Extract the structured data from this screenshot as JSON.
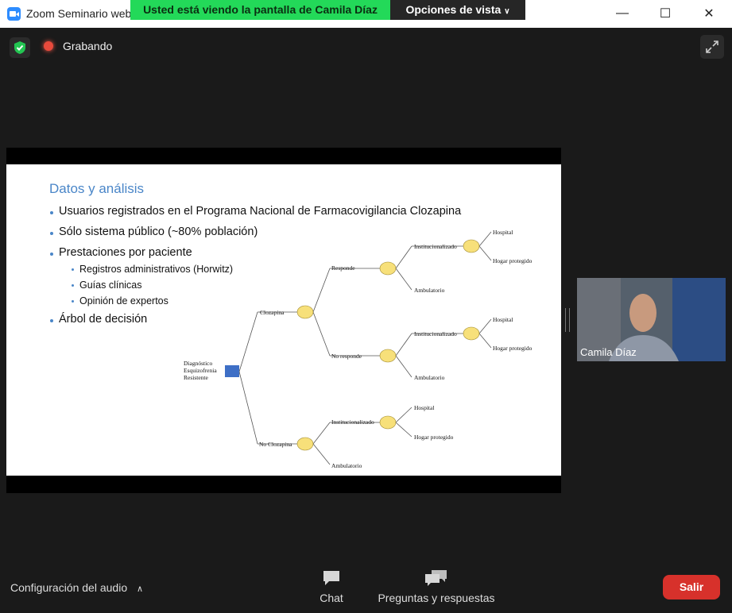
{
  "window": {
    "title": "Zoom Seminario web",
    "controls": {
      "minimize": "—",
      "maximize": "☐",
      "close": "✕"
    }
  },
  "share_banner": {
    "text": "Usted está viendo la pantalla de Camila Díaz",
    "view_options": "Opciones de vista"
  },
  "status": {
    "recording": "Grabando"
  },
  "slide": {
    "title": "Datos y análisis",
    "bullets": [
      "Usuarios registrados en el Programa Nacional de Farmacovigilancia Clozapina",
      "Sólo sistema público (~80% población)",
      "Prestaciones por paciente",
      "Árbol de decisión"
    ],
    "sub_bullets": [
      "Registros administrativos (Horwitz)",
      "Guías clínicas",
      "Opinión de expertos"
    ],
    "tree": {
      "root": [
        "Diagnóstico",
        "Esquizofrenia",
        "Resistente"
      ],
      "clozapina": "Clozapina",
      "no_clozapina": "No Clozapina",
      "responde": "Responde",
      "no_responde": "No responde",
      "institucionalizado": "Institucionalizado",
      "ambulatorio": "Ambulatorio",
      "hospital": "Hospital",
      "hogar_protegido": "Hogar protegido"
    }
  },
  "video": {
    "participant_name": "Camila Díaz"
  },
  "toolbar": {
    "audio_settings": "Configuración del audio",
    "chat": "Chat",
    "qa": "Preguntas y respuestas",
    "leave": "Salir"
  },
  "colors": {
    "banner_green": "#23d959",
    "leave_red": "#d7312b",
    "slide_title_blue": "#4a86c8",
    "node_yellow": "#f7e07a",
    "root_blue": "#3e6fc6"
  }
}
